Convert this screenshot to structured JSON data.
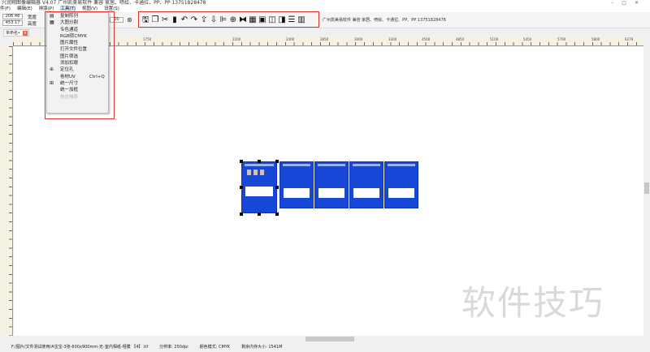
{
  "title": "兴润翔图像编辑器 V4.07 广州凯美易软件 兼容 家居、喷绘、卡通拉、PP、PP 13751828478",
  "menu": [
    "件(F)",
    "编辑(E)",
    "排版(P)",
    "工具(T)",
    "视图(V)",
    "设置(S)"
  ],
  "size": {
    "width_value": "206.46",
    "width_label": "宽度",
    "height_value": "453.17",
    "height_label": "高度",
    "zoom_value": "00"
  },
  "toolbar_icons": [
    "save-icon",
    "copy-icon",
    "cut-icon",
    "paste-icon",
    "undo-icon",
    "redo-icon",
    "export-icon",
    "import-icon",
    "align-left-icon",
    "target-icon",
    "mirror-icon",
    "grid-icon",
    "image-icon",
    "layout-icon",
    "flip-icon",
    "align-center-icon",
    "columns-icon"
  ],
  "company": "广州凯美易软件 兼容 家居、喷绘、卡通拉、PP、PP   13751828478",
  "tab": {
    "label": "未命名•"
  },
  "ruler_labels": [
    "1750",
    "2200",
    "2400",
    "2850",
    "3000",
    "3300",
    "4500",
    "4850",
    "5100",
    "5450",
    "5700",
    "5800",
    "6279"
  ],
  "tools_menu": [
    {
      "label": "复制阵列",
      "icon": "grid-copy-icon"
    },
    {
      "label": "大图分割",
      "icon": "split-grid-icon"
    },
    {
      "label": "专色通道"
    },
    {
      "label": "RGB转CMYK"
    },
    {
      "label": "图片属性"
    },
    {
      "label": "打开文件位置"
    },
    {
      "label": "图片筛选"
    },
    {
      "label": "添加扣眼"
    },
    {
      "label": "定位孔",
      "icon": "target-icon"
    },
    {
      "label": "卷材UV",
      "shortcut": "Ctrl+Q"
    },
    {
      "label": "统一尺寸",
      "icon": "resize-icon"
    },
    {
      "label": "统一加框"
    },
    {
      "label": "热交排序",
      "disabled": true
    }
  ],
  "status": {
    "path": "F:/图片/文件测试使用/A宝宝-3张-600x900mm-无-室内相纸-哑膜 【4】.tif",
    "resolution": "分辨率: 250dpi",
    "color_mode": "颜色模式: CMYK",
    "memory": "剩余内存大小: 1541M"
  },
  "watermark": "软件技巧",
  "colors": {
    "accent_red": "#dd3333",
    "print_blue": "#1747d6"
  }
}
